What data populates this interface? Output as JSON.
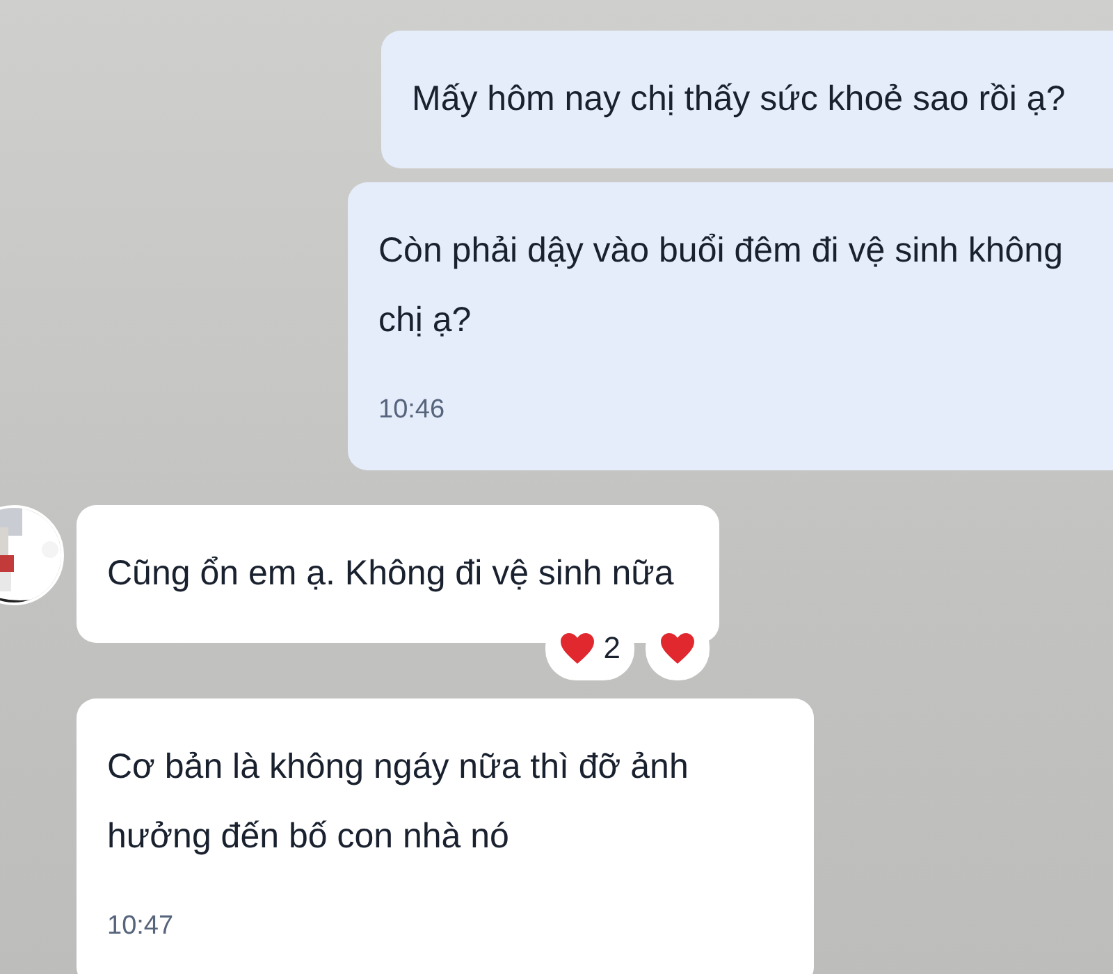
{
  "messages": [
    {
      "kind": "sent",
      "text": "Mấy hôm nay chị thấy sức khoẻ sao rồi ạ?"
    },
    {
      "kind": "sent",
      "text": "Còn phải dậy vào buổi đêm đi vệ sinh không chị ạ?",
      "time": "10:46"
    },
    {
      "kind": "received",
      "text": "Cũng ổn em ạ. Không đi vệ sinh nữa",
      "reactions": [
        {
          "kind": "heart",
          "count": "2"
        },
        {
          "kind": "heart"
        }
      ]
    },
    {
      "kind": "received",
      "text": "Cơ bản là không ngáy nữa thì đỡ ảnh hưởng đến bố con nhà nó",
      "time": "10:47"
    }
  ]
}
